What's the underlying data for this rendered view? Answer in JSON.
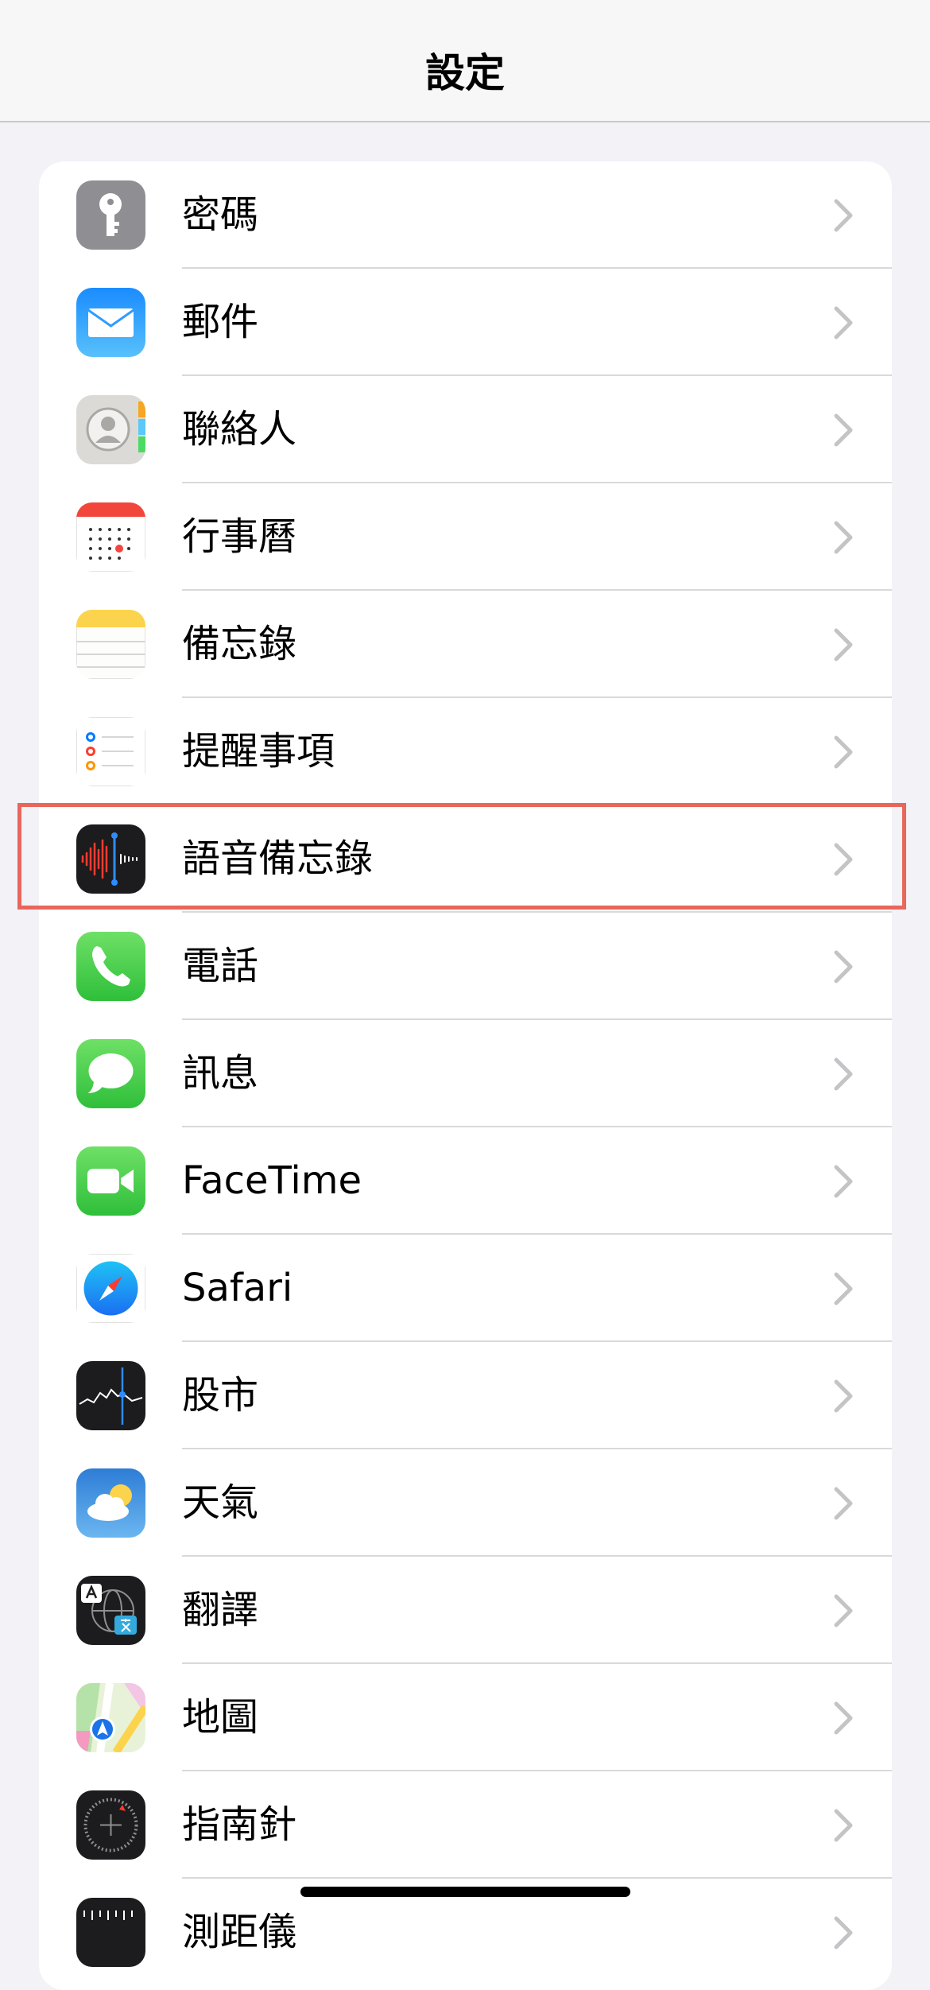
{
  "navbar": {
    "title": "設定"
  },
  "rows": [
    {
      "label": "密碼",
      "icon": "key-icon"
    },
    {
      "label": "郵件",
      "icon": "mail-icon"
    },
    {
      "label": "聯絡人",
      "icon": "contacts-icon"
    },
    {
      "label": "行事曆",
      "icon": "calendar-icon"
    },
    {
      "label": "備忘錄",
      "icon": "notes-icon"
    },
    {
      "label": "提醒事項",
      "icon": "reminders-icon"
    },
    {
      "label": "語音備忘錄",
      "icon": "voice-memos-icon"
    },
    {
      "label": "電話",
      "icon": "phone-icon"
    },
    {
      "label": "訊息",
      "icon": "messages-icon"
    },
    {
      "label": "FaceTime",
      "icon": "facetime-icon"
    },
    {
      "label": "Safari",
      "icon": "safari-icon"
    },
    {
      "label": "股市",
      "icon": "stocks-icon"
    },
    {
      "label": "天氣",
      "icon": "weather-icon"
    },
    {
      "label": "翻譯",
      "icon": "translate-icon"
    },
    {
      "label": "地圖",
      "icon": "maps-icon"
    },
    {
      "label": "指南針",
      "icon": "compass-icon"
    },
    {
      "label": "測距儀",
      "icon": "measure-icon"
    }
  ],
  "colors": {
    "highlight": "#e8665a",
    "background": "#f2f2f7"
  }
}
